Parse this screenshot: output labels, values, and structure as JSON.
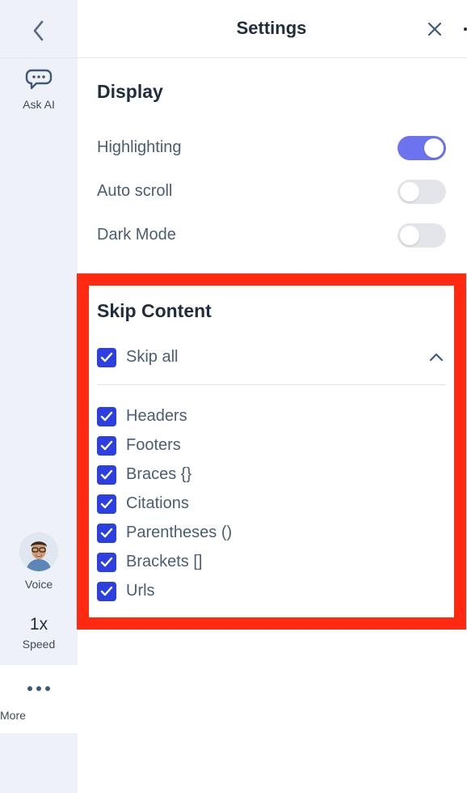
{
  "sidebar": {
    "ask_ai_label": "Ask AI",
    "voice_label": "Voice",
    "speed_value": "1x",
    "speed_label": "Speed",
    "more_label": "More"
  },
  "header": {
    "title": "Settings"
  },
  "display": {
    "title": "Display",
    "toggles": [
      {
        "label": "Highlighting",
        "on": true
      },
      {
        "label": "Auto scroll",
        "on": false
      },
      {
        "label": "Dark Mode",
        "on": false
      }
    ]
  },
  "skip_content": {
    "title": "Skip Content",
    "skip_all": {
      "label": "Skip all",
      "checked": true
    },
    "items": [
      {
        "label": "Headers",
        "checked": true
      },
      {
        "label": "Footers",
        "checked": true
      },
      {
        "label": "Braces {}",
        "checked": true
      },
      {
        "label": "Citations",
        "checked": true
      },
      {
        "label": "Parentheses ()",
        "checked": true
      },
      {
        "label": "Brackets []",
        "checked": true
      },
      {
        "label": "Urls",
        "checked": true
      }
    ]
  },
  "colors": {
    "accent": "#2c3fe0",
    "toggle_on": "#6c73ef",
    "highlight_frame": "#ff2a0f",
    "rail_bg": "#eef1f7"
  },
  "icons": {
    "back": "chevron-left-icon",
    "ask_ai": "speech-bubble-icon",
    "more": "ellipsis-icon",
    "close": "close-icon",
    "collapse": "chevron-up-icon",
    "check": "check-icon"
  }
}
